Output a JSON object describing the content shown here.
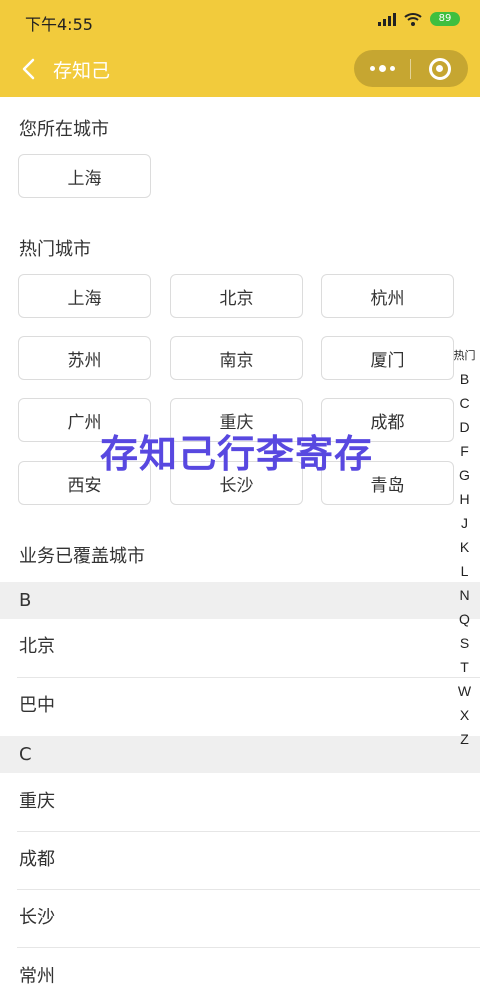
{
  "status_bar": {
    "time": "下午4:55",
    "battery": "89"
  },
  "nav": {
    "title": "存知己"
  },
  "current_city": {
    "title": "您所在城市",
    "city": "上海"
  },
  "hot_cities": {
    "title": "热门城市",
    "cities": [
      "上海",
      "北京",
      "杭州",
      "苏州",
      "南京",
      "厦门",
      "广州",
      "重庆",
      "成都",
      "西安",
      "长沙",
      "青岛"
    ]
  },
  "covered": {
    "title": "业务已覆盖城市",
    "groups": [
      {
        "letter": "B",
        "cities": [
          "北京",
          "巴中"
        ]
      },
      {
        "letter": "C",
        "cities": [
          "重庆",
          "成都",
          "长沙",
          "常州"
        ]
      }
    ]
  },
  "index_bar": [
    "热门",
    "B",
    "C",
    "D",
    "F",
    "G",
    "H",
    "J",
    "K",
    "L",
    "N",
    "Q",
    "S",
    "T",
    "W",
    "X",
    "Z"
  ],
  "watermark": "存知己行李寄存",
  "colors": {
    "header": "#f2cb3c",
    "watermark": "#5848e0"
  }
}
